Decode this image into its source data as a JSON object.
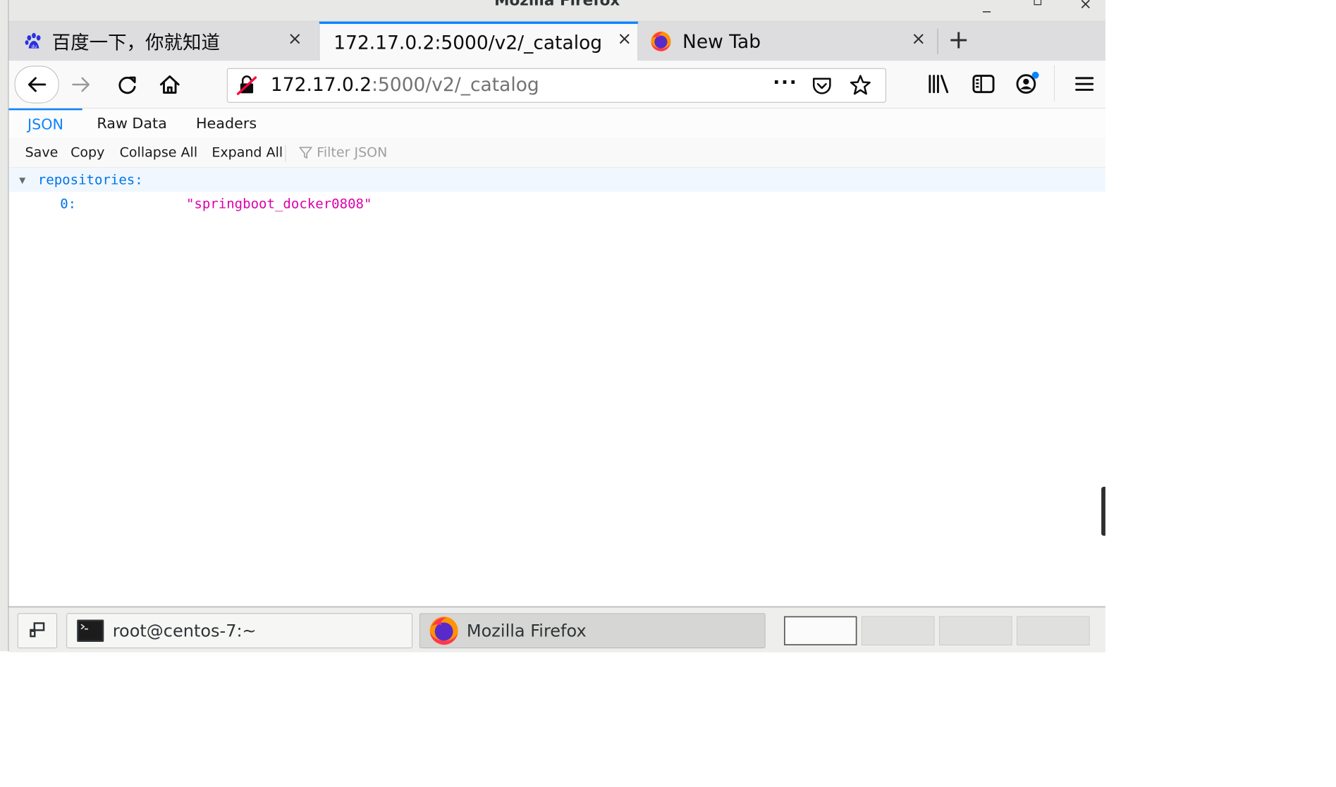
{
  "window": {
    "title": "Mozilla Firefox"
  },
  "tabs": [
    {
      "label": "百度一下，你就知道",
      "close": "×",
      "icon": "baidu-paw-icon"
    },
    {
      "label": "172.17.0.2:5000/v2/_catalog",
      "close": "×",
      "active": true
    },
    {
      "label": "New Tab",
      "close": "×",
      "icon": "firefox-icon"
    }
  ],
  "new_tab": "+",
  "url": {
    "host": "172.17.0.2",
    "path": ":5000/v2/_catalog"
  },
  "json_viewer": {
    "tabs": [
      "JSON",
      "Raw Data",
      "Headers"
    ],
    "toolbar": [
      "Save",
      "Copy",
      "Collapse All",
      "Expand All"
    ],
    "filter_placeholder": "Filter JSON",
    "root_key": "repositories:",
    "items": [
      {
        "index": "0:",
        "value": "\"springboot_docker0808\""
      }
    ]
  },
  "taskbar": {
    "terminal": "root@centos-7:~",
    "firefox": "Mozilla Firefox"
  },
  "colors": {
    "accent": "#0a84ff",
    "json_key": "#0074e8",
    "json_string": "#dd00a9"
  }
}
